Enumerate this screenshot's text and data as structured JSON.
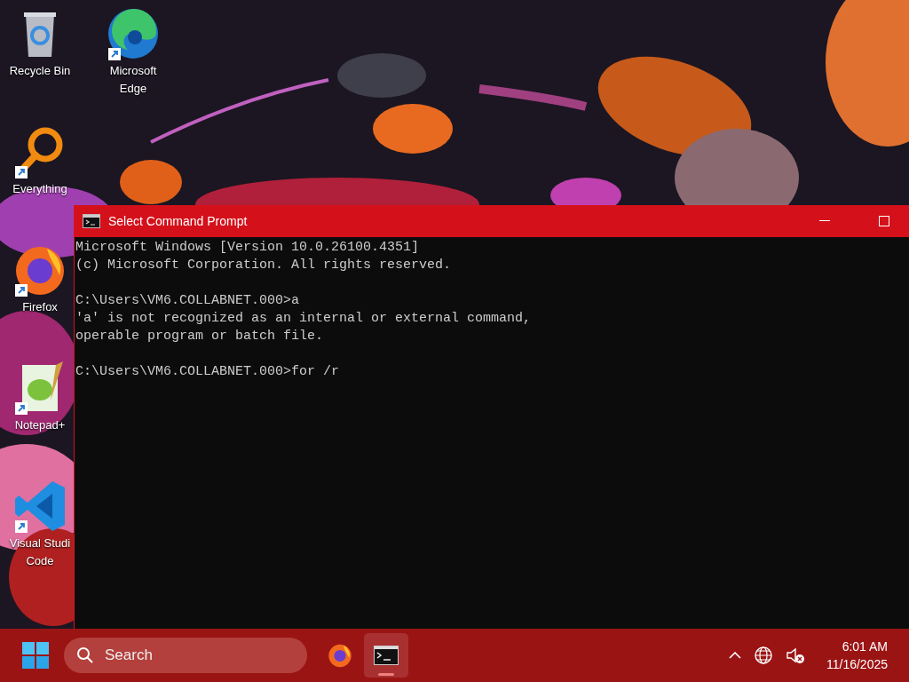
{
  "desktop": {
    "columns": [
      [
        {
          "label": "Recycle Bin",
          "kind": "recycle"
        },
        {
          "label": "Everything",
          "kind": "everything",
          "shortcut": true
        },
        {
          "label": "Firefox",
          "kind": "firefox",
          "shortcut": true
        },
        {
          "label": "Notepad+",
          "kind": "notepad",
          "shortcut": true
        },
        {
          "label": "Visual Studi Code",
          "kind": "vscode",
          "shortcut": true
        }
      ],
      [
        {
          "label": "Microsoft Edge",
          "kind": "edge",
          "shortcut": true
        }
      ]
    ]
  },
  "window": {
    "title": "Select Command Prompt",
    "blocks": [
      [
        "Microsoft Windows [Version 10.0.26100.4351]",
        "(c) Microsoft Corporation. All rights reserved."
      ],
      [
        "C:\\Users\\VM6.COLLABNET.000>a",
        "'a' is not recognized as an internal or external command,",
        "operable program or batch file."
      ],
      [
        "C:\\Users\\VM6.COLLABNET.000>for /r"
      ]
    ]
  },
  "taskbar": {
    "search": {
      "placeholder": "Search"
    },
    "apps": [
      {
        "kind": "firefox",
        "selected": false
      },
      {
        "kind": "terminal",
        "selected": true
      }
    ],
    "clock": {
      "time": "6:01 AM",
      "date": "11/16/2025"
    }
  }
}
